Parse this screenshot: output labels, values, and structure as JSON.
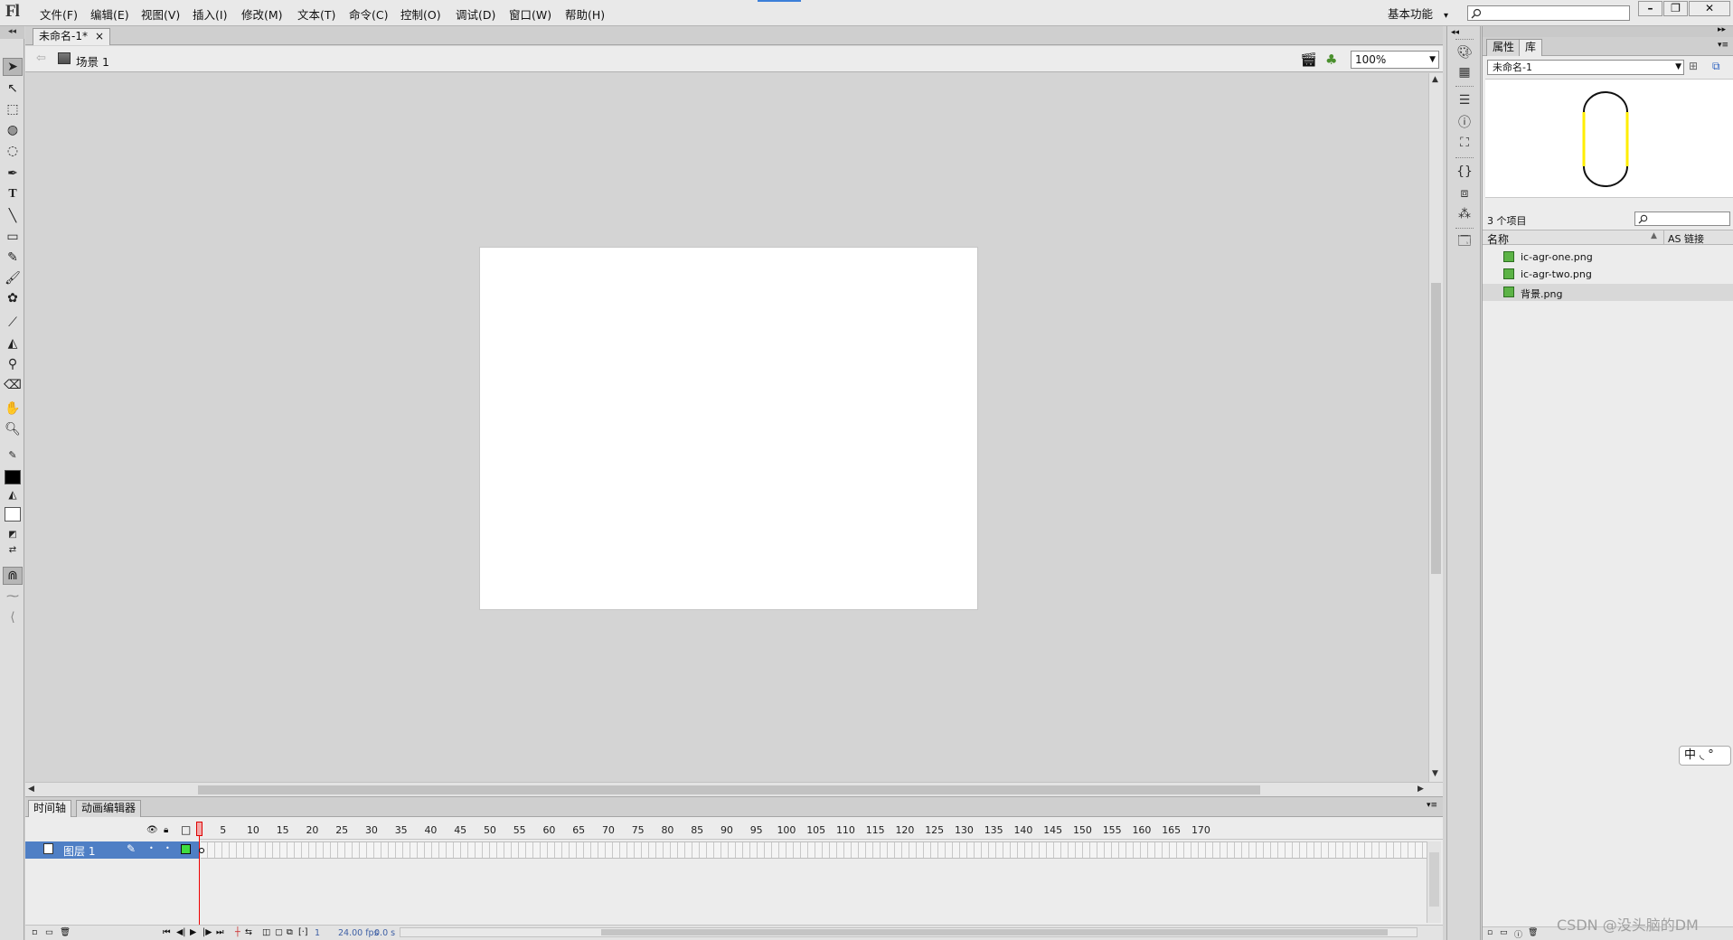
{
  "app": {
    "logo": "Fl"
  },
  "menu": [
    "文件(F)",
    "编辑(E)",
    "视图(V)",
    "插入(I)",
    "修改(M)",
    "文本(T)",
    "命令(C)",
    "控制(O)",
    "调试(D)",
    "窗口(W)",
    "帮助(H)"
  ],
  "workspace": {
    "label": "基本功能",
    "arrow": "▾"
  },
  "window_controls": {
    "minimize": "–",
    "restore": "❐",
    "close": "✕"
  },
  "document": {
    "tab_title": "未命名-1*",
    "tab_close": "×",
    "scene_label": "场景 1"
  },
  "zoom": {
    "value": "100%"
  },
  "timeline": {
    "tabs": [
      "时间轴",
      "动画编辑器"
    ],
    "frame_numbers": [
      "1",
      "5",
      "10",
      "15",
      "20",
      "25",
      "30",
      "35",
      "40",
      "45",
      "50",
      "55",
      "60",
      "65",
      "70",
      "75",
      "80",
      "85",
      "90",
      "95",
      "100",
      "105",
      "110",
      "115",
      "120",
      "125",
      "130",
      "135",
      "140",
      "145",
      "150",
      "155",
      "160",
      "165",
      "170"
    ],
    "layer_name": "图层 1",
    "status_frame": "1",
    "status_fps": "24.00 fps",
    "status_time": "0.0 s"
  },
  "library": {
    "tabs": [
      "属性",
      "库"
    ],
    "doc_select": "未命名-1",
    "item_count": "3 个项目",
    "col_name": "名称",
    "col_linkage": "AS 链接",
    "items": [
      "ic-agr-one.png",
      "ic-agr-two.png",
      "背景.png"
    ]
  },
  "ime": {
    "label": "中 ◟ °"
  },
  "watermark": "CSDN @没头脑的DM",
  "colors": {
    "stroke": "#000000",
    "fill": "#ffffff",
    "layer_selected": "#4f7fc5",
    "playhead": "#dd0000",
    "preview_yellow": "#ffee00"
  }
}
